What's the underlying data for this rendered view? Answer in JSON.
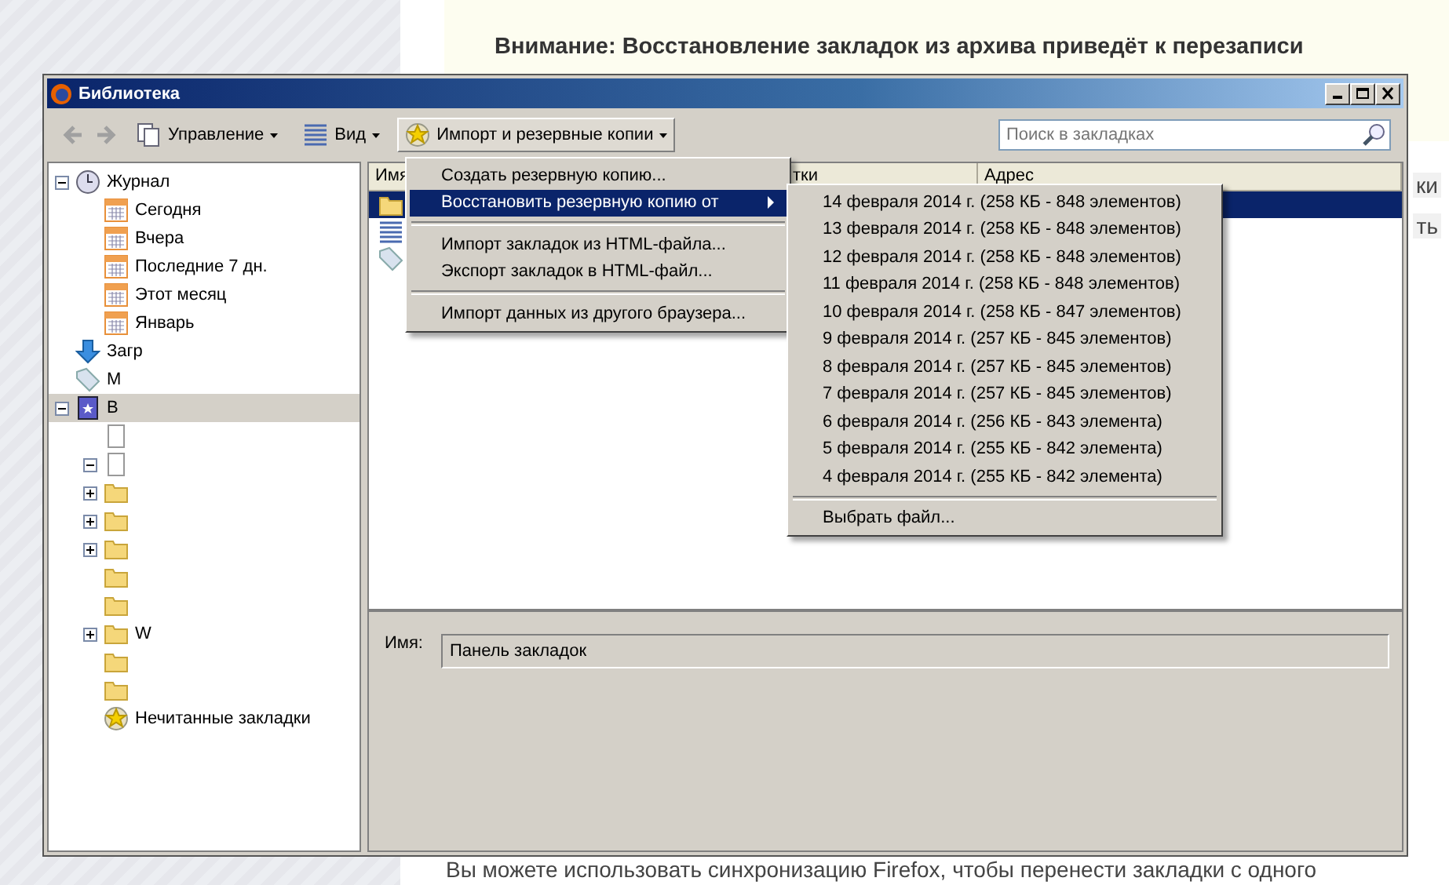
{
  "page": {
    "notice": "Внимание: Восстановление закладок из архива приведёт к перезаписи",
    "fragments": [
      "ки",
      "ть"
    ],
    "footer": "Вы можете использовать синхронизацию Firefox, чтобы перенести закладки с одного"
  },
  "window": {
    "title": "Библиотека"
  },
  "toolbar": {
    "buttons": [
      {
        "label": "Управление",
        "kind": "pages",
        "selected": false
      },
      {
        "label": "Вид",
        "kind": "list",
        "selected": false
      },
      {
        "label": "Импорт и резервные копии",
        "kind": "star",
        "selected": true
      }
    ],
    "search": {
      "placeholder": "Поиск в закладках"
    }
  },
  "sidebar": {
    "items": [
      {
        "label": "Журнал",
        "kind": "clock",
        "expanded": true,
        "selected": false,
        "children": [
          {
            "label": "Сегодня",
            "kind": "calendar",
            "selected": false
          },
          {
            "label": "Вчера",
            "kind": "calendar",
            "selected": false
          },
          {
            "label": "Последние 7 дн.",
            "kind": "calendar",
            "selected": false
          },
          {
            "label": "Этот месяц",
            "kind": "calendar",
            "selected": false
          },
          {
            "label": "Январь",
            "kind": "calendar",
            "selected": false
          }
        ]
      },
      {
        "label": "Загр",
        "kind": "download",
        "selected": false
      },
      {
        "label": "М",
        "kind": "tag",
        "selected": false
      },
      {
        "label": "В",
        "kind": "book",
        "expanded": true,
        "selected": true,
        "children": [
          {
            "kind": "page",
            "selected": false
          },
          {
            "kind": "page",
            "expanded": true,
            "selected": false
          },
          {
            "kind": "folder",
            "expanded": false,
            "selected": false
          },
          {
            "kind": "folder",
            "expanded": false,
            "selected": false
          },
          {
            "kind": "folder",
            "expanded": false,
            "selected": false
          },
          {
            "kind": "folder",
            "selected": false
          },
          {
            "kind": "folder",
            "selected": false
          },
          {
            "label": "W",
            "kind": "folder",
            "expanded": false,
            "selected": false
          },
          {
            "kind": "folder",
            "selected": false
          },
          {
            "kind": "folder",
            "selected": false
          },
          {
            "label": "Нечитанные закладки",
            "kind": "star",
            "selected": false
          }
        ]
      }
    ]
  },
  "table": {
    "columns": [
      "Имя",
      "тки",
      "Адрес"
    ],
    "rows": [
      {
        "kind": "folder",
        "selected": true
      },
      {
        "kind": "list",
        "selected": false
      },
      {
        "kind": "tag",
        "selected": false
      }
    ]
  },
  "details": {
    "label": "Имя:",
    "value": "Панель закладок"
  },
  "menu": {
    "items": [
      {
        "kind": "item",
        "label": "Создать резервную копию...",
        "selected": false
      },
      {
        "kind": "submenu",
        "label": "Восстановить резервную копию от",
        "selected": true
      },
      {
        "kind": "separator"
      },
      {
        "kind": "item",
        "label": "Импорт закладок из HTML-файла...",
        "selected": false
      },
      {
        "kind": "item",
        "label": "Экспорт закладок в HTML-файл...",
        "selected": false
      },
      {
        "kind": "separator"
      },
      {
        "kind": "item",
        "label": "Импорт данных из другого браузера...",
        "selected": false
      }
    ]
  },
  "submenu": {
    "items": [
      {
        "kind": "item",
        "label": "14 февраля 2014 г. (258 КБ - 848 элементов)"
      },
      {
        "kind": "item",
        "label": "13 февраля 2014 г. (258 КБ - 848 элементов)"
      },
      {
        "kind": "item",
        "label": "12 февраля 2014 г. (258 КБ - 848 элементов)"
      },
      {
        "kind": "item",
        "label": "11 февраля 2014 г. (258 КБ - 848 элементов)"
      },
      {
        "kind": "item",
        "label": "10 февраля 2014 г. (258 КБ - 847 элементов)"
      },
      {
        "kind": "item",
        "label": "9 февраля 2014 г. (257 КБ - 845 элементов)"
      },
      {
        "kind": "item",
        "label": "8 февраля 2014 г. (257 КБ - 845 элементов)"
      },
      {
        "kind": "item",
        "label": "7 февраля 2014 г. (257 КБ - 845 элементов)"
      },
      {
        "kind": "item",
        "label": "6 февраля 2014 г. (256 КБ - 843 элемента)"
      },
      {
        "kind": "item",
        "label": "5 февраля 2014 г. (255 КБ - 842 элемента)"
      },
      {
        "kind": "item",
        "label": "4 февраля 2014 г. (255 КБ - 842 элемента)"
      },
      {
        "kind": "separator"
      },
      {
        "kind": "item",
        "label": "Выбрать файл..."
      }
    ]
  }
}
